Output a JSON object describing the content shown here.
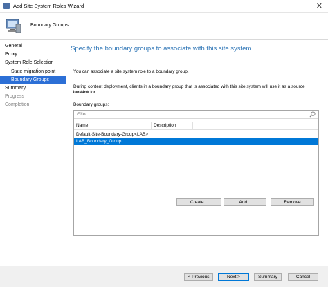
{
  "window": {
    "title": "Add Site System Roles Wizard",
    "close_glyph": "✕"
  },
  "header": {
    "title": "Boundary Groups"
  },
  "nav": {
    "items": [
      {
        "label": "General",
        "state": "normal"
      },
      {
        "label": "Proxy",
        "state": "normal"
      },
      {
        "label": "System Role Selection",
        "state": "normal"
      },
      {
        "label": "State migration point",
        "state": "normal"
      },
      {
        "label": "Boundary Groups",
        "state": "active"
      },
      {
        "label": "Summary",
        "state": "normal"
      },
      {
        "label": "Progress",
        "state": "disabled"
      },
      {
        "label": "Completion",
        "state": "disabled"
      }
    ]
  },
  "main": {
    "title": "Specify the boundary groups to associate with this site system",
    "intro": "You can associate a site system role to a boundary group.",
    "description_line1": "During content deployment, clients in a boundary group that is associated with this site system will use it as a source location for",
    "description_line2": "content.",
    "list_label": "Boundary groups:",
    "filter_placeholder": "Filter...",
    "columns": [
      "Name",
      "Description"
    ],
    "rows": [
      {
        "name": "Default-Site-Boundary-Group<LAB>",
        "selected": false
      },
      {
        "name": "LAB_Boundary_Group",
        "selected": true
      }
    ],
    "buttons": {
      "create": "Create...",
      "add": "Add...",
      "remove": "Remove"
    }
  },
  "footer": {
    "previous": "< Previous",
    "next": "Next >",
    "summary": "Summary",
    "cancel": "Cancel"
  },
  "colors": {
    "accent": "#2c6fd6",
    "title_blue": "#2e75b6",
    "selection": "#0078d7"
  }
}
